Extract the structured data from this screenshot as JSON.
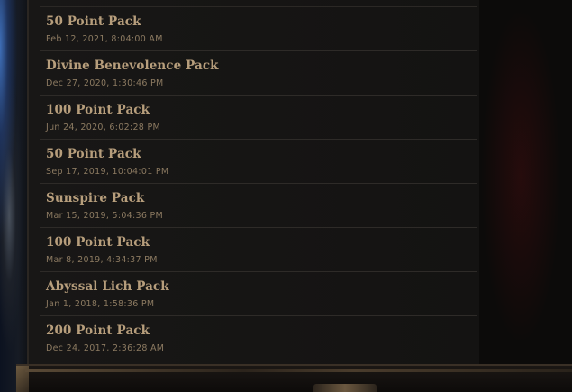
{
  "purchases": [
    {
      "name": "50 Point Pack",
      "date": "Feb 12, 2021, 8:04:00 AM"
    },
    {
      "name": "Divine Benevolence Pack",
      "date": "Dec 27, 2020, 1:30:46 PM"
    },
    {
      "name": "100 Point Pack",
      "date": "Jun 24, 2020, 6:02:28 PM"
    },
    {
      "name": "50 Point Pack",
      "date": "Sep 17, 2019, 10:04:01 PM"
    },
    {
      "name": "Sunspire Pack",
      "date": "Mar 15, 2019, 5:04:36 PM"
    },
    {
      "name": "100 Point Pack",
      "date": "Mar 8, 2019, 4:34:37 PM"
    },
    {
      "name": "Abyssal Lich Pack",
      "date": "Jan 1, 2018, 1:58:36 PM"
    },
    {
      "name": "200 Point Pack",
      "date": "Dec 24, 2017, 2:36:28 AM"
    }
  ],
  "colors": {
    "title": "#b79e7c",
    "date": "#8c7a61",
    "divider": "#2e2b28",
    "panel": "#161514"
  }
}
